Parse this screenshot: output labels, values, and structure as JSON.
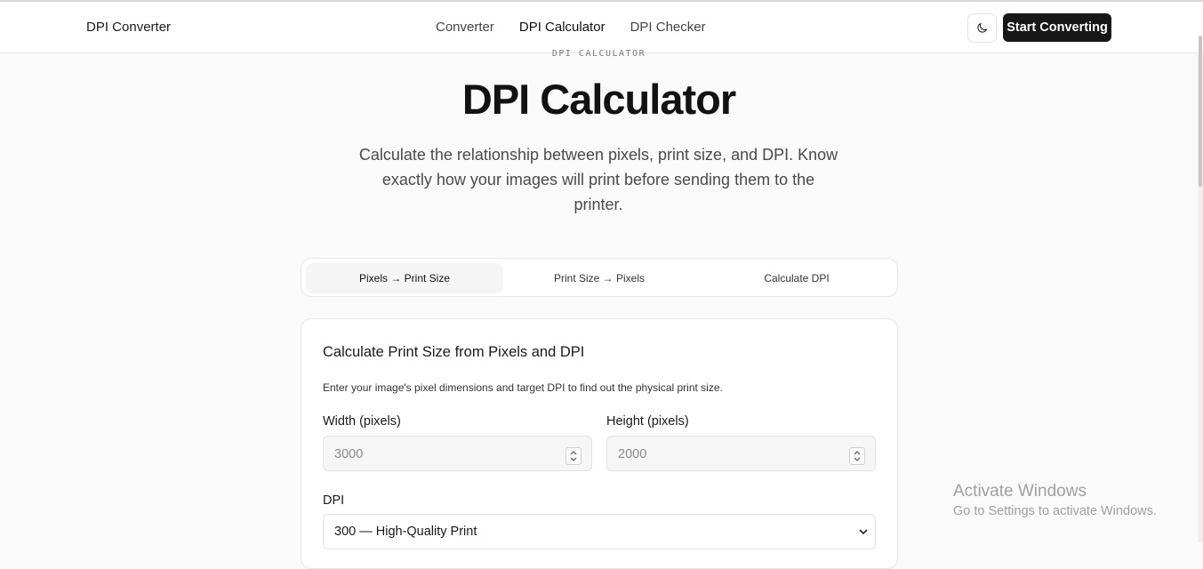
{
  "header": {
    "brand": "DPI Converter",
    "nav": [
      "Converter",
      "DPI Calculator",
      "DPI Checker"
    ],
    "active_nav": "DPI Calculator",
    "theme_icon": "moon-icon",
    "cta_label": "Start Converting"
  },
  "hero": {
    "eyebrow": "DPI CALCULATOR",
    "title": "DPI Calculator",
    "subtitle": "Calculate the relationship between pixels, print size, and DPI. Know exactly how your images will print before sending them to the printer."
  },
  "tabs": {
    "items": [
      "Pixels → Print Size",
      "Print Size → Pixels",
      "Calculate DPI"
    ],
    "active": "Pixels → Print Size"
  },
  "card": {
    "title": "Calculate Print Size from Pixels and DPI",
    "description": "Enter your image's pixel dimensions and target DPI to find out the physical print size.",
    "width_label": "Width (pixels)",
    "width_value": "3000",
    "height_label": "Height (pixels)",
    "height_value": "2000",
    "dpi_label": "DPI",
    "dpi_selected": "300 — High-Quality Print"
  },
  "watermark": {
    "title": "Activate Windows",
    "subtitle": "Go to Settings to activate Windows."
  },
  "colors": {
    "background": "#fafafa",
    "primary_button": "#171717",
    "text": "#1a1a1a"
  }
}
